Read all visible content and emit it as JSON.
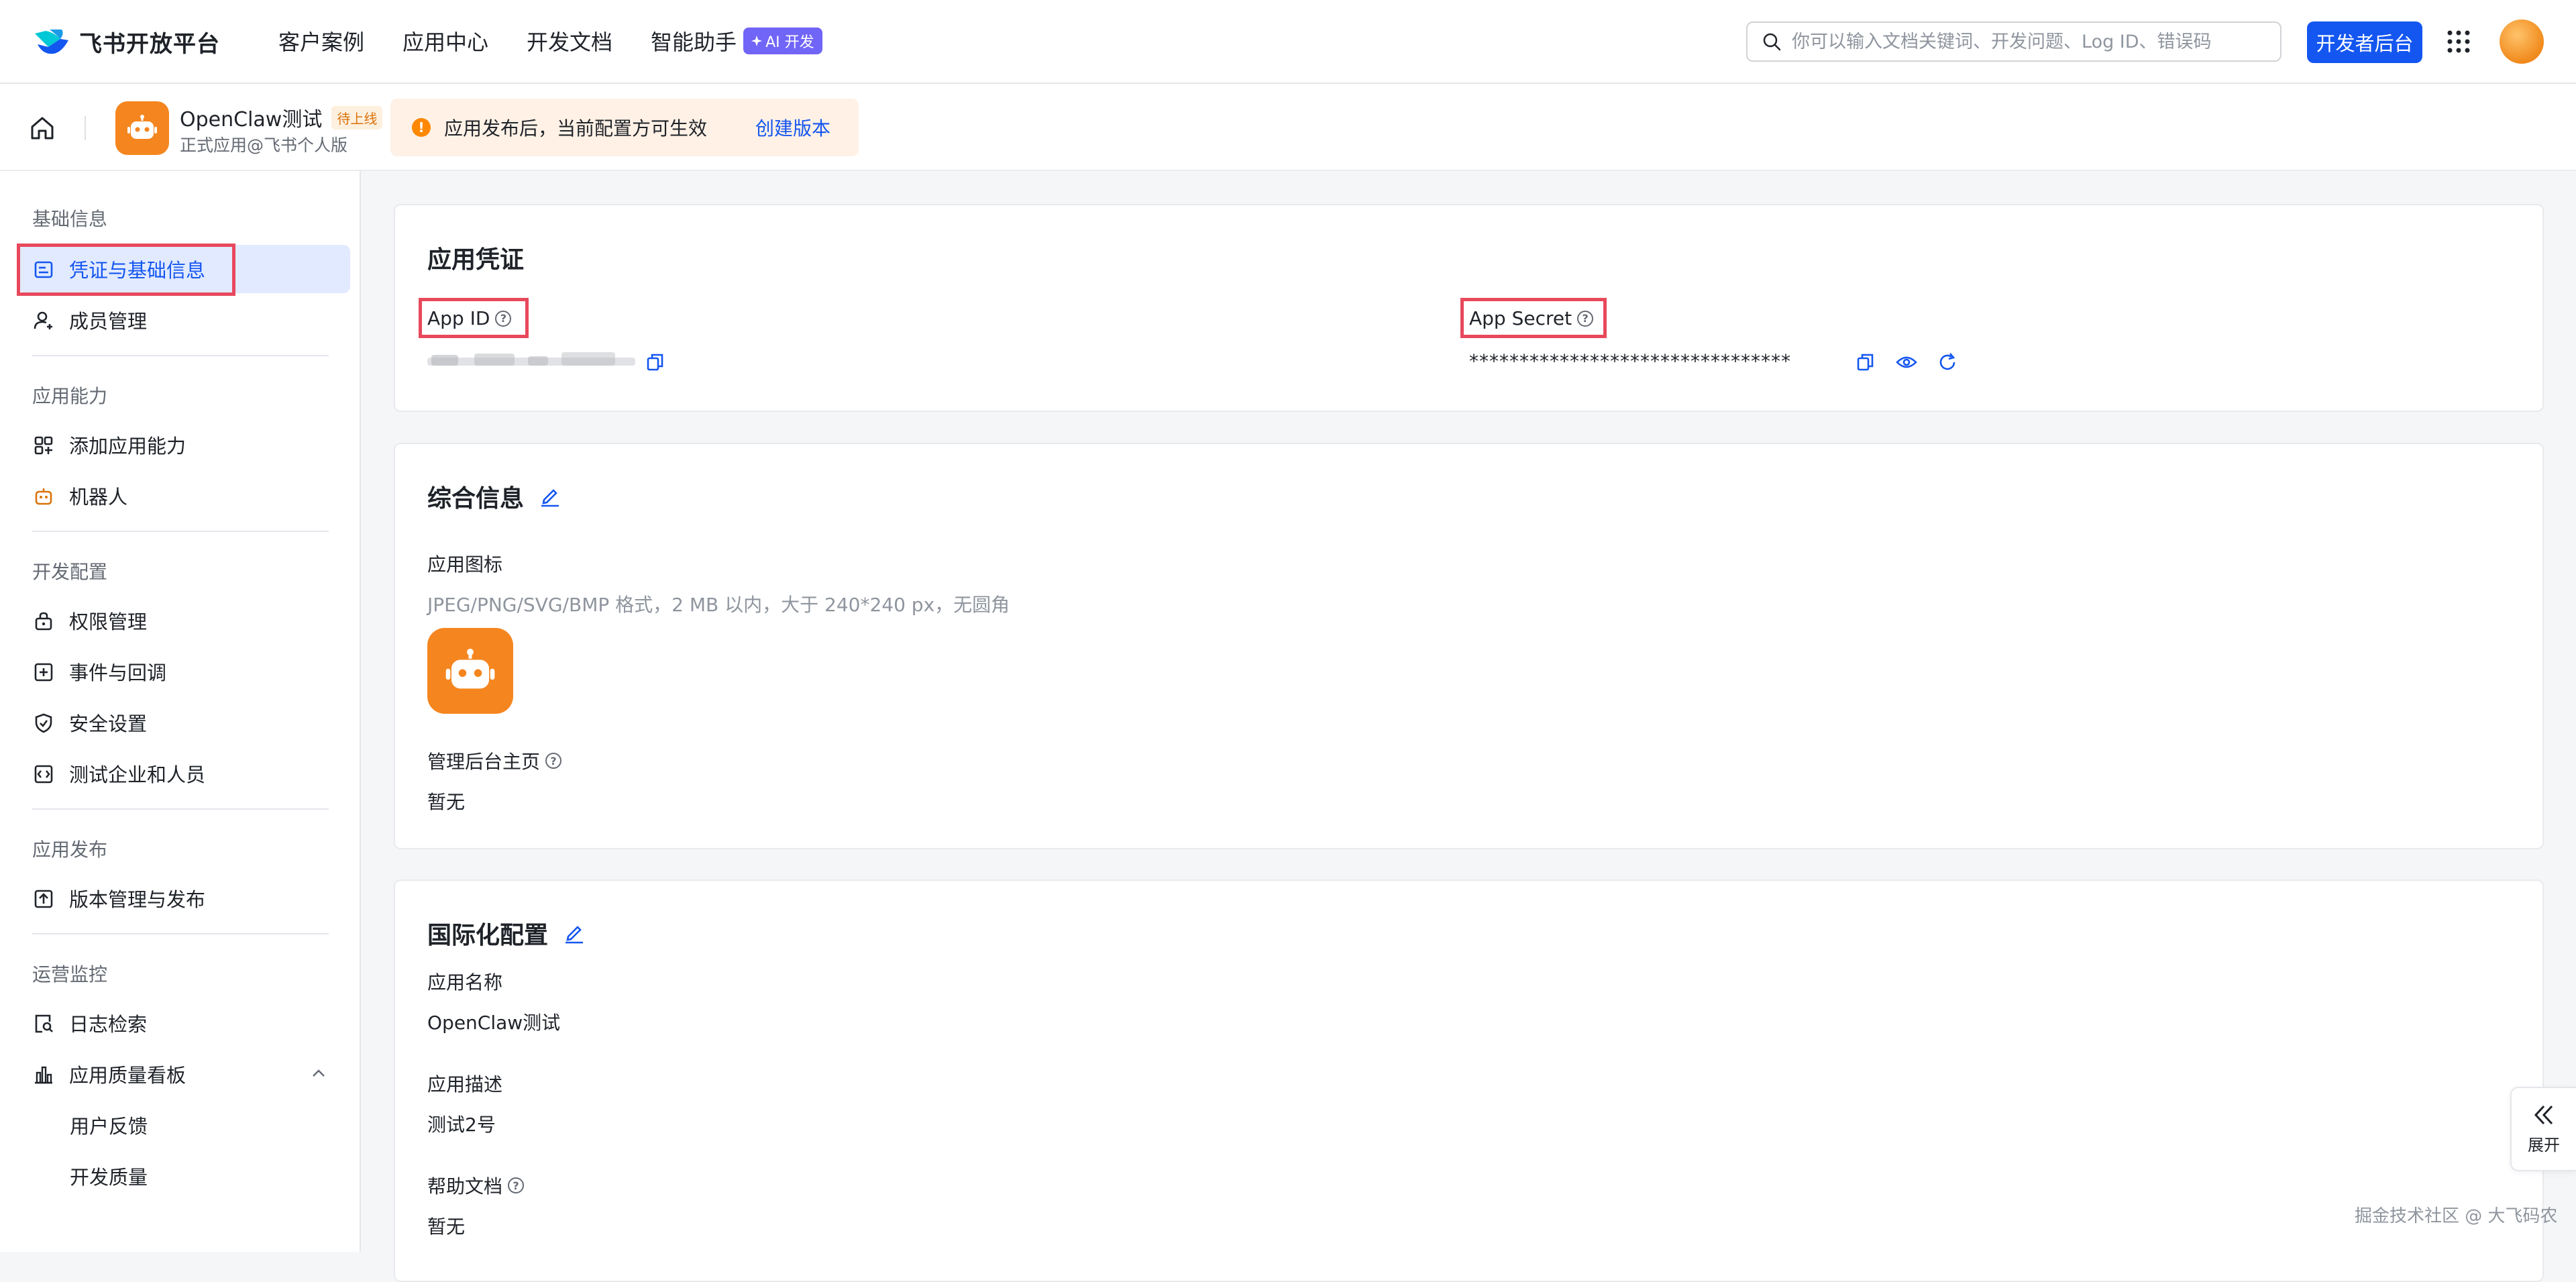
{
  "topbar": {
    "brand": "飞书开放平台",
    "nav": [
      "客户案例",
      "应用中心",
      "开发文档"
    ],
    "ai_nav": "智能助手",
    "ai_badge": "AI 开发",
    "search_placeholder": "你可以输入文档关键词、开发问题、Log ID、错误码",
    "dev_button": "开发者后台"
  },
  "appbar": {
    "app_name": "OpenClaw测试",
    "status_badge": "待上线",
    "app_subtitle": "正式应用@飞书个人版",
    "notice_icon": "!",
    "notice_text": "应用发布后，当前配置方可生效",
    "notice_link": "创建版本"
  },
  "sidebar": {
    "groups": {
      "basic": "基础信息",
      "capability": "应用能力",
      "dev_config": "开发配置",
      "release": "应用发布",
      "ops": "运营监控"
    },
    "items": {
      "credentials": "凭证与基础信息",
      "members": "成员管理",
      "add_capability": "添加应用能力",
      "bot": "机器人",
      "permissions": "权限管理",
      "events": "事件与回调",
      "security": "安全设置",
      "test_enterprise": "测试企业和人员",
      "version": "版本管理与发布",
      "log_search": "日志检索",
      "quality": "应用质量看板",
      "feedback": "用户反馈",
      "dev_quality": "开发质量"
    }
  },
  "credentials": {
    "title": "应用凭证",
    "app_id_label": "App ID",
    "app_secret_label": "App Secret",
    "app_secret_value": "********************************"
  },
  "general": {
    "title": "综合信息",
    "icon_label": "应用图标",
    "icon_hint": "JPEG/PNG/SVG/BMP 格式，2 MB 以内，大于 240*240 px，无圆角",
    "admin_home_label": "管理后台主页",
    "admin_home_value": "暂无"
  },
  "i18n": {
    "title": "国际化配置",
    "name_label": "应用名称",
    "name_value": "OpenClaw测试",
    "desc_label": "应用描述",
    "desc_value": "测试2号",
    "help_label": "帮助文档",
    "help_value": "暂无"
  },
  "expand_label": "展开",
  "watermark": "掘金技术社区 @ 大飞码农",
  "colors": {
    "primary": "#1456f0",
    "app_orange": "#f5861f",
    "highlight_red": "#e8485c",
    "active_bg": "#e1eaff",
    "ai_purple": "#7165f7"
  },
  "icons": {
    "brand": "feishu-logo",
    "search": "search-icon",
    "apps": "apps-grid-icon",
    "home": "home-icon",
    "copy": "copy-icon",
    "view": "eye-icon",
    "refresh": "refresh-icon",
    "edit": "edit-icon",
    "help": "question-icon"
  }
}
